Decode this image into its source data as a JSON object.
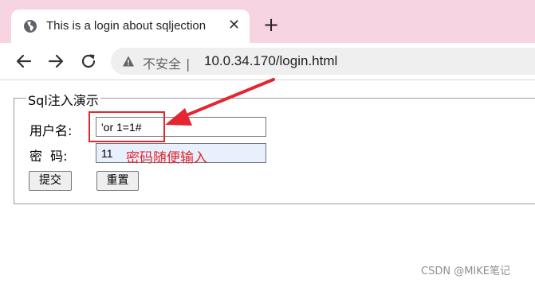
{
  "browser": {
    "tab_title": "This is a login about sqljection",
    "tab_close_glyph": "✕",
    "new_tab_glyph": "+",
    "address": {
      "security_label": "不安全",
      "separator": "|",
      "url": "10.0.34.170/login.html"
    },
    "icons": [
      "globe-icon",
      "close-icon",
      "plus-icon",
      "back-icon",
      "forward-icon",
      "reload-icon",
      "warning-icon"
    ]
  },
  "form": {
    "legend": "Sql注入演示",
    "username_label": "用户名:",
    "username_value": "'or 1=1#",
    "password_label": "密  码:",
    "password_value": "11",
    "submit_label": "提交",
    "reset_label": "重置"
  },
  "annotation": {
    "note": "密码随便输入",
    "color": "#e3262f"
  },
  "watermark": "CSDN @MIKE笔记",
  "colors": {
    "tabstrip": "#f7d4e2",
    "omnibox": "#efefef",
    "autofill": "#e8f0fe"
  }
}
